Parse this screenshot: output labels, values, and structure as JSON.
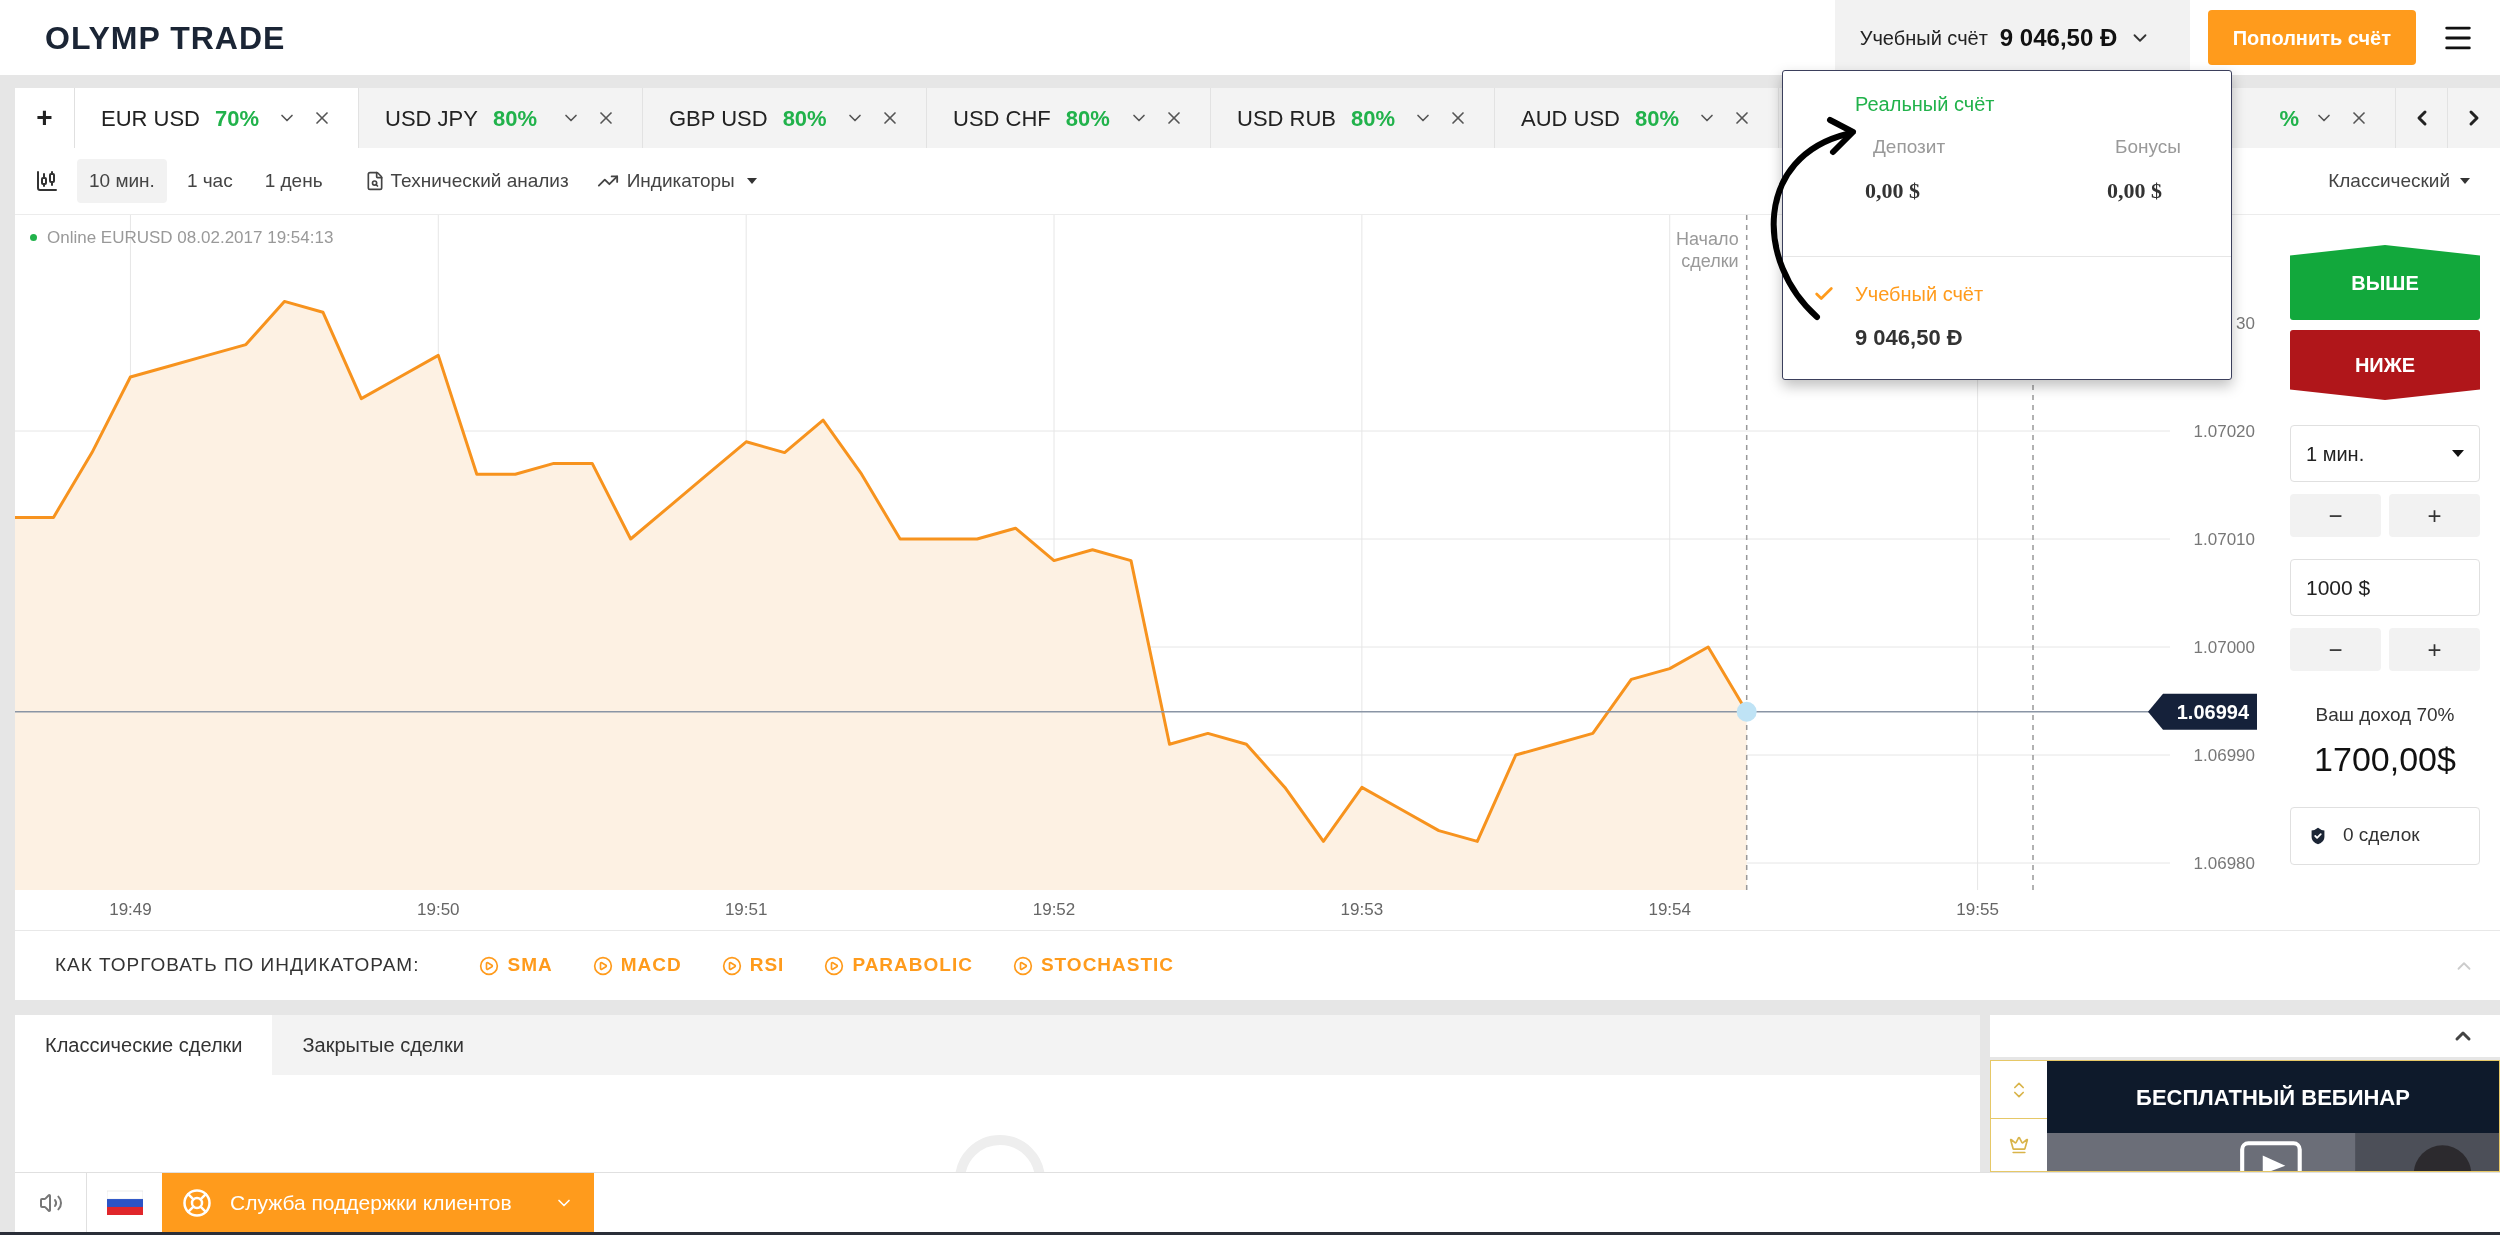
{
  "header": {
    "logo": "OLYMP TRADE",
    "account_label": "Учебный счёт",
    "account_balance": "9 046,50 Đ",
    "deposit_button": "Пополнить счёт"
  },
  "add_tab": "+",
  "tabs": [
    {
      "pair": "EUR USD",
      "payout": "70%",
      "selected": true
    },
    {
      "pair": "USD JPY",
      "payout": "80%",
      "selected": false
    },
    {
      "pair": "GBP USD",
      "payout": "80%",
      "selected": false
    },
    {
      "pair": "USD CHF",
      "payout": "80%",
      "selected": false
    },
    {
      "pair": "USD RUB",
      "payout": "80%",
      "selected": false
    },
    {
      "pair": "AUD USD",
      "payout": "80%",
      "selected": false
    },
    {
      "payout": "%",
      "selected": false
    }
  ],
  "toolbar": {
    "periods": [
      {
        "label": "10 мин.",
        "selected": true
      },
      {
        "label": "1 час",
        "selected": false
      },
      {
        "label": "1 день",
        "selected": false
      }
    ],
    "analysis": "Технический анализ",
    "indicators": "Индикаторы",
    "chart_type": "Классический"
  },
  "chart": {
    "status": "Online EURUSD 08.02.2017 19:54:13",
    "price_badge": "1.06994",
    "cut_tick_label": "30",
    "chart_data": {
      "type": "area",
      "grid": true,
      "ylim": [
        1.069775,
        1.0704
      ],
      "categories": [
        null,
        null,
        null,
        "19:49",
        null,
        null,
        null,
        null,
        null,
        null,
        null,
        "19:50",
        null,
        null,
        null,
        null,
        null,
        null,
        null,
        "19:51",
        null,
        null,
        null,
        null,
        null,
        null,
        null,
        "19:52",
        null,
        null,
        null,
        null,
        null,
        null,
        null,
        "19:53",
        null,
        null,
        null,
        null,
        null,
        null,
        null,
        "19:54",
        null,
        null,
        null,
        null,
        null,
        null,
        null,
        "19:55",
        null,
        null,
        null,
        null,
        null
      ],
      "yticks": [
        {
          "value": 1.0698,
          "label": "1.06980"
        },
        {
          "value": 1.0699,
          "label": "1.06990"
        },
        {
          "value": 1.07,
          "label": "1.07000"
        },
        {
          "value": 1.0701,
          "label": "1.07010"
        },
        {
          "value": 1.0702,
          "label": "1.07020"
        }
      ],
      "series": [
        {
          "color": "#f7931e",
          "values": [
            1.07012,
            1.07012,
            1.07018,
            1.07025,
            1.07026,
            1.07027,
            1.07028,
            1.07032,
            1.07031,
            1.07023,
            1.07025,
            1.07027,
            1.07016,
            1.07016,
            1.07017,
            1.07017,
            1.0701,
            1.07013,
            1.07016,
            1.07019,
            1.07018,
            1.07021,
            1.07016,
            1.0701,
            1.0701,
            1.0701,
            1.07011,
            1.07008,
            1.07009,
            1.07008,
            1.06991,
            1.06992,
            1.06991,
            1.06987,
            1.06982,
            1.06987,
            1.06985,
            1.06983,
            1.06982,
            1.0699,
            1.06991,
            1.06992,
            1.06997,
            1.06998,
            1.07,
            1.06994,
            null,
            null,
            null,
            null,
            null,
            null,
            null,
            null,
            null,
            null,
            null
          ]
        }
      ],
      "annotations": [
        "Начало сделки"
      ],
      "ref_lines": [
        {
          "axis": "y",
          "value": 1.06994
        }
      ]
    }
  },
  "trade_panel": {
    "up": "ВЫШЕ",
    "down": "НИЖЕ",
    "duration": "1 мин.",
    "duration_steps": [
      "−",
      "+"
    ],
    "amount": "1000 $",
    "amount_steps": [
      "−",
      "+"
    ],
    "income_label": "Ваш доход 70%",
    "income": "1700,00$",
    "deals": "0 сделок"
  },
  "indicators_bar": {
    "title": "КАК ТОРГОВАТЬ ПО ИНДИКАТОРАМ:",
    "links": [
      "SMA",
      "MACD",
      "RSI",
      "PARABOLIC",
      "STOCHASTIC"
    ]
  },
  "deals_tabs": [
    {
      "label": "Классические сделки",
      "selected": true
    },
    {
      "label": "Закрытые сделки",
      "selected": false
    }
  ],
  "webinar": {
    "title": "БЕСПЛАТНЫЙ ВЕБИНАР"
  },
  "footer": {
    "support": "Служба поддержки клиентов"
  },
  "account_menu": {
    "accounts": [
      {
        "name": "Реальный счёт",
        "selected": false,
        "fields": [
          {
            "label": "Депозит",
            "value": "0,00 $"
          },
          {
            "label": "Бонусы",
            "value": "0,00 $"
          }
        ]
      },
      {
        "name": "Учебный счёт",
        "selected": true,
        "balance": "9 046,50 Đ"
      }
    ]
  }
}
